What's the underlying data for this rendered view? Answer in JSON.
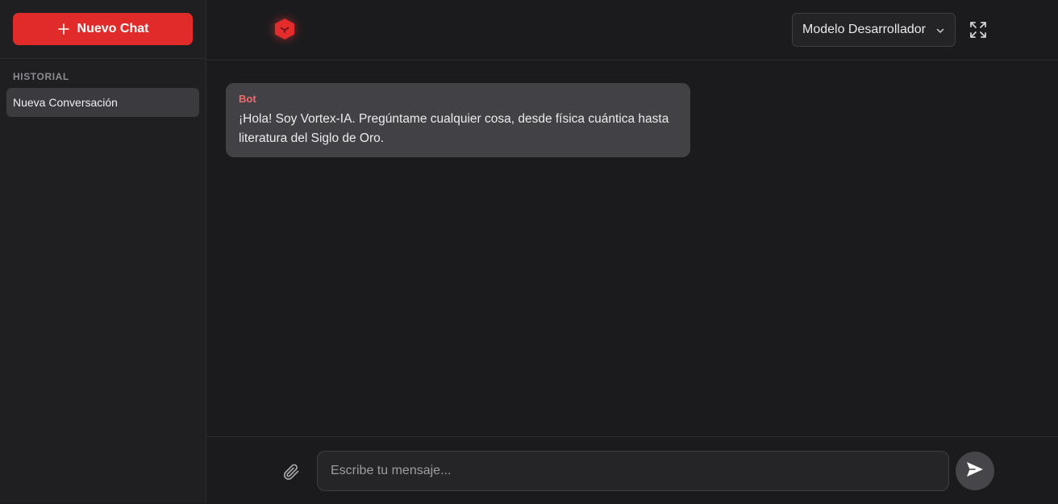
{
  "sidebar": {
    "new_chat_label": "Nuevo Chat",
    "history_heading": "HISTORIAL",
    "history_items": [
      {
        "label": "Nueva Conversación"
      }
    ]
  },
  "header": {
    "model_selected": "Modelo Desarrollador",
    "icons": [
      "logo-icon",
      "chevron-down-icon",
      "fullscreen-icon"
    ]
  },
  "messages": [
    {
      "sender": "Bot",
      "text": "¡Hola! Soy Vortex-IA. Pregúntame cualquier cosa, desde física cuántica hasta literatura del Siglo de Oro."
    }
  ],
  "composer": {
    "placeholder": "Escribe tu mensaje...",
    "value": "",
    "icons": [
      "paperclip-icon",
      "send-icon"
    ]
  },
  "colors": {
    "accent": "#e12a2a",
    "sender_label": "#f26a6a",
    "background": "#1b1b1d",
    "sidebar": "#1f1f21",
    "bubble": "#414146"
  }
}
